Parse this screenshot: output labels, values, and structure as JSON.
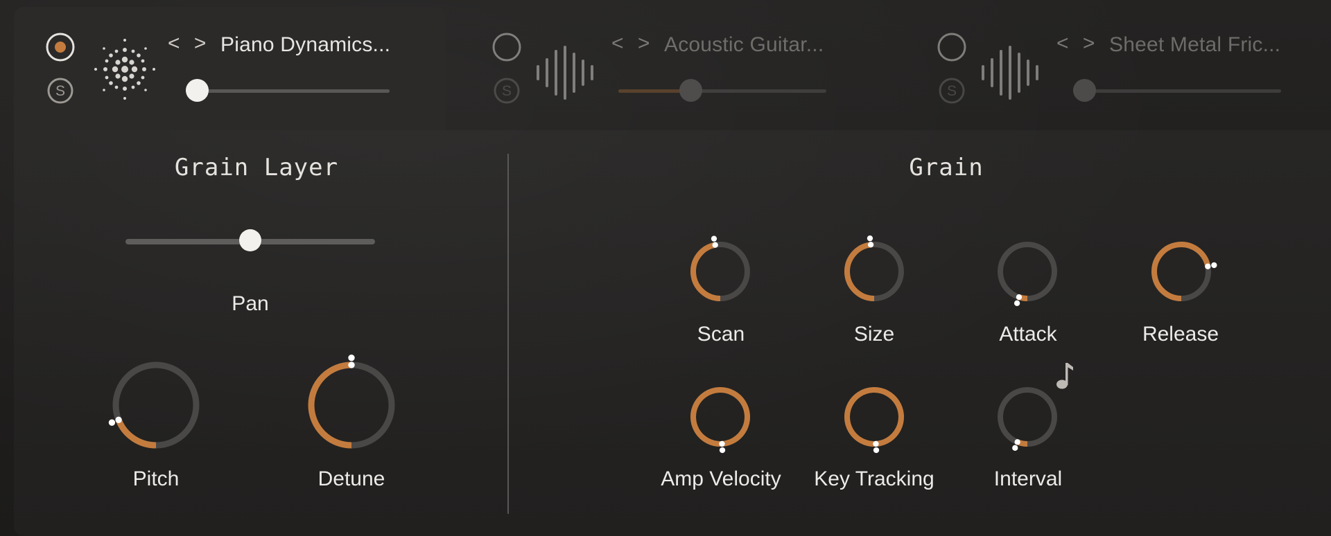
{
  "layers": [
    {
      "name": "Piano Dynamics...",
      "nav_label": "< >",
      "state": "active",
      "slider_value": 0.0,
      "waveform_icon": "sparkle-dots-icon",
      "record_icon": "record-circle-icon",
      "solo_label": "S"
    },
    {
      "name": "Acoustic Guitar...",
      "nav_label": "< >",
      "state": "inactive",
      "slider_value": 0.33,
      "waveform_icon": "waveform-bars-icon",
      "record_icon": "record-circle-icon",
      "solo_label": "S"
    },
    {
      "name": "Sheet Metal Fric...",
      "nav_label": "< >",
      "state": "inactive",
      "slider_value": 0.0,
      "waveform_icon": "waveform-bars-icon",
      "record_icon": "record-circle-icon",
      "solo_label": "S"
    }
  ],
  "grain_layer": {
    "title": "Grain Layer",
    "pan": {
      "label": "Pan",
      "value": 0.5
    },
    "knobs": [
      {
        "id": "pitch",
        "label": "Pitch",
        "value": 0.19
      },
      {
        "id": "detune",
        "label": "Detune",
        "value": 0.5
      }
    ]
  },
  "grain": {
    "title": "Grain",
    "knobs": [
      {
        "id": "scan",
        "label": "Scan",
        "value": 0.47
      },
      {
        "id": "size",
        "label": "Size",
        "value": 0.48
      },
      {
        "id": "attack",
        "label": "Attack",
        "value": 0.05
      },
      {
        "id": "release",
        "label": "Release",
        "value": 0.72
      },
      {
        "id": "amp-velocity",
        "label": "Amp Velocity",
        "value": 0.99
      },
      {
        "id": "key-tracking",
        "label": "Key Tracking",
        "value": 0.99
      },
      {
        "id": "interval",
        "label": "Interval",
        "value": 0.06
      }
    ],
    "interval_sync_icon": "music-note-icon"
  },
  "colors": {
    "accent": "#c47c3e",
    "track": "#4a4846",
    "thumb": "#ffffff",
    "text": "#ecebe8",
    "dim_text": "#b7b3ae"
  }
}
